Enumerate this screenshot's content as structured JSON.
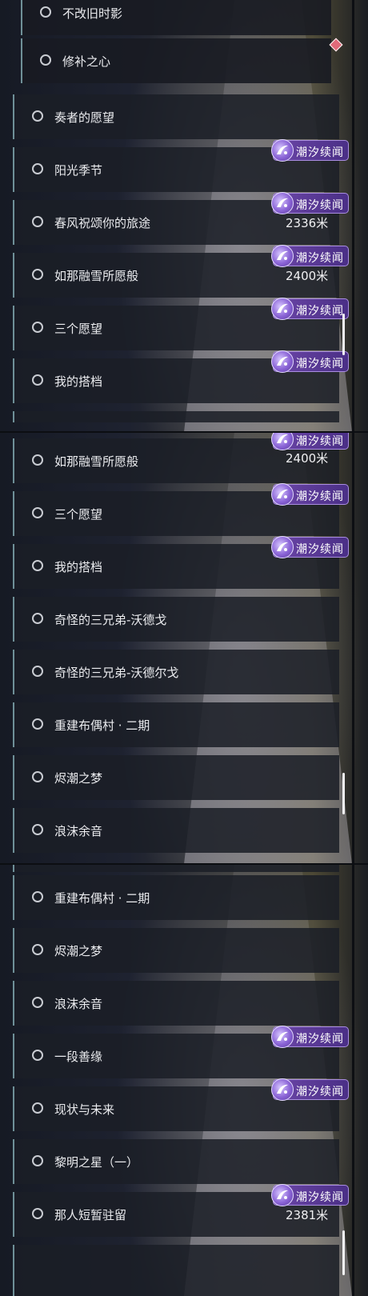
{
  "badge_label": "潮汐续闻",
  "panel1": {
    "items": [
      {
        "label": "不改旧时影"
      },
      {
        "label": "修补之心"
      },
      {
        "label": "奏者的愿望"
      },
      {
        "label": "阳光季节"
      },
      {
        "label": "春风祝颂你的旅途"
      },
      {
        "label": "如那融雪所愿般"
      },
      {
        "label": "三个愿望"
      },
      {
        "label": "我的搭档"
      }
    ],
    "distances": [
      "2336米",
      "2400米"
    ]
  },
  "panel2": {
    "items": [
      {
        "label": "如那融雪所愿般"
      },
      {
        "label": "三个愿望"
      },
      {
        "label": "我的搭档"
      },
      {
        "label": "奇怪的三兄弟-沃德戈"
      },
      {
        "label": "奇怪的三兄弟-沃德尔戈"
      },
      {
        "label": "重建布偶村 · 二期"
      },
      {
        "label": "烬潮之梦"
      },
      {
        "label": "浪沫余音"
      }
    ],
    "distances": [
      "2400米"
    ]
  },
  "panel3": {
    "items": [
      {
        "label": "重建布偶村 · 二期"
      },
      {
        "label": "烬潮之梦"
      },
      {
        "label": "浪沫余音"
      },
      {
        "label": "一段善缘"
      },
      {
        "label": "现状与未来"
      },
      {
        "label": "黎明之星（一）"
      },
      {
        "label": "那人短暂驻留"
      }
    ],
    "distances": [
      "2381米"
    ]
  }
}
